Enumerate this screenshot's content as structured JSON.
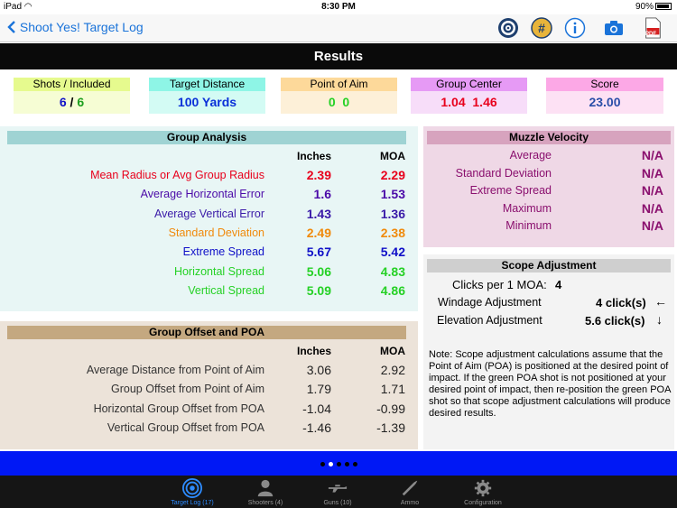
{
  "status": {
    "device": "iPad",
    "time": "8:30 PM",
    "battery": "90%"
  },
  "nav": {
    "back_label": "Shoot Yes! Target Log",
    "pdf_label": "PDF"
  },
  "title": "Results",
  "summary": {
    "shots_header": "Shots / Included",
    "shots_total": "6",
    "shots_sep": "/",
    "shots_included": "6",
    "distance_header": "Target Distance",
    "distance_value": "100 Yards",
    "poa_header": "Point of Aim",
    "poa_x": "0",
    "poa_y": "0",
    "center_header": "Group Center",
    "center_x": "1.04",
    "center_y": "1.46",
    "score_header": "Score",
    "score_value": "23.00"
  },
  "group_analysis": {
    "title": "Group Analysis",
    "col_inches": "Inches",
    "col_moa": "MOA",
    "rows": [
      {
        "label": "Mean Radius or Avg Group Radius",
        "inches": "2.39",
        "moa": "2.29",
        "color": "#e8001c"
      },
      {
        "label": "Average Horizontal Error",
        "inches": "1.6",
        "moa": "1.53",
        "color": "#4b0aa8"
      },
      {
        "label": "Average Vertical Error",
        "inches": "1.43",
        "moa": "1.36",
        "color": "#3a1aa8"
      },
      {
        "label": "Standard Deviation",
        "inches": "2.49",
        "moa": "2.38",
        "color": "#f08a0c"
      },
      {
        "label": "Extreme Spread",
        "inches": "5.67",
        "moa": "5.42",
        "color": "#1010c8"
      },
      {
        "label": "Horizontal Spread",
        "inches": "5.06",
        "moa": "4.83",
        "color": "#25d125"
      },
      {
        "label": "Vertical Spread",
        "inches": "5.09",
        "moa": "4.86",
        "color": "#25d125"
      }
    ]
  },
  "group_offset": {
    "title": "Group Offset and POA",
    "col_inches": "Inches",
    "col_moa": "MOA",
    "rows": [
      {
        "label": "Average Distance from Point of Aim",
        "inches": "3.06",
        "moa": "2.92"
      },
      {
        "label": "Group Offset from Point of Aim",
        "inches": "1.79",
        "moa": "1.71"
      },
      {
        "label": "Horizontal Group Offset from POA",
        "inches": "-1.04",
        "moa": "-0.99"
      },
      {
        "label": "Vertical Group Offset from POA",
        "inches": "-1.46",
        "moa": "-1.39"
      }
    ]
  },
  "muzzle_velocity": {
    "title": "Muzzle Velocity",
    "rows": [
      {
        "label": "Average",
        "value": "N/A"
      },
      {
        "label": "Standard Deviation",
        "value": "N/A"
      },
      {
        "label": "Extreme Spread",
        "value": "N/A"
      },
      {
        "label": "Maximum",
        "value": "N/A"
      },
      {
        "label": "Minimum",
        "value": "N/A"
      }
    ]
  },
  "scope_adjustment": {
    "title": "Scope Adjustment",
    "clicks_label": "Clicks per 1 MOA:",
    "clicks_value": "4",
    "windage_label": "Windage Adjustment",
    "windage_value": "4 click(s)",
    "windage_arrow": "←",
    "elevation_label": "Elevation Adjustment",
    "elevation_value": "5.6 click(s)",
    "elevation_arrow": "↓",
    "note": "Note: Scope adjustment calculations assume that the Point of Aim (POA) is positioned at the desired point of impact. If the green POA shot is not positioned at your desired point of impact, then re-position the green POA shot so that scope adjustment calculations will produce desired results."
  },
  "tabs": [
    {
      "label": "Target Log (17)",
      "icon": "target-icon",
      "active": true
    },
    {
      "label": "Shooters (4)",
      "icon": "person-icon",
      "active": false
    },
    {
      "label": "Guns (10)",
      "icon": "rifle-icon",
      "active": false
    },
    {
      "label": "Ammo",
      "icon": "bullet-icon",
      "active": false
    },
    {
      "label": "Configuration",
      "icon": "gear-icon",
      "active": false
    }
  ],
  "colors": {
    "accent": "#1a73d9",
    "bluebar": "#0018f5",
    "muzzle_value": "#8a0f6e",
    "muzzle_label": "#8a0f6e"
  }
}
